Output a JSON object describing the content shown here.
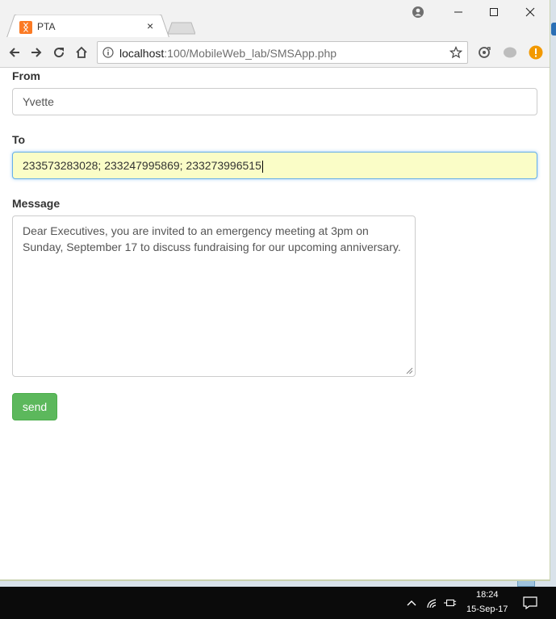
{
  "browser": {
    "tab_title": "PTA",
    "tab_close": "×",
    "url_host": "localhost",
    "url_rest": ":100/MobileWeb_lab/SMSApp.php"
  },
  "form": {
    "from_label": "From",
    "from_value": "Yvette",
    "to_label": "To",
    "to_value": "233573283028; 233247995869; 233273996515",
    "message_label": "Message",
    "message_value": "Dear Executives, you are invited to an emergency meeting at 3pm on Sunday, September 17 to discuss fundraising for our upcoming anniversary.",
    "send_label": "send"
  },
  "taskbar": {
    "time": "18:24",
    "date": "15-Sep-17"
  },
  "colors": {
    "send_button": "#5cb85c",
    "focused_field": "#fafdc7",
    "favicon": "#fb7a24"
  }
}
